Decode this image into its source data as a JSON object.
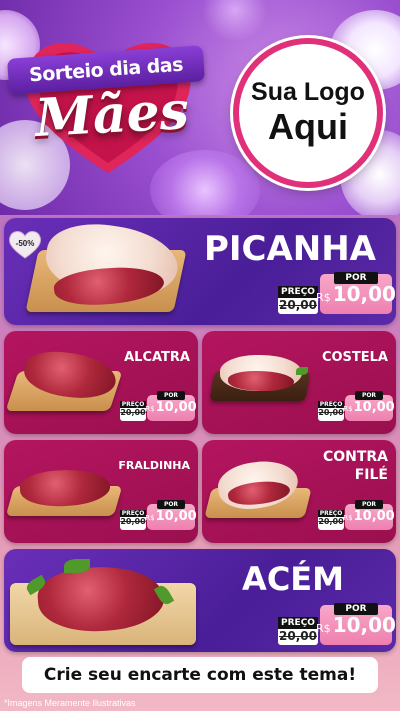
{
  "header": {
    "ribbon_text": "Sorteio dia das",
    "title": "Mães",
    "logo_line1": "Sua Logo",
    "logo_line2": "Aqui"
  },
  "badge": "-50%",
  "products": [
    {
      "name": "PICANHA",
      "price_label": "PREÇO",
      "old_price": "20,00",
      "por_label": "POR",
      "currency": "R$",
      "new_price": "10,00"
    },
    {
      "name": "ALCATRA",
      "price_label": "PREÇO",
      "old_price": "20,00",
      "por_label": "POR",
      "currency": "R$",
      "new_price": "10,00"
    },
    {
      "name": "COSTELA",
      "price_label": "PREÇO",
      "old_price": "20,00",
      "por_label": "POR",
      "currency": "R$",
      "new_price": "10,00"
    },
    {
      "name": "FRALDINHA",
      "price_label": "PREÇO",
      "old_price": "20,00",
      "por_label": "POR",
      "currency": "R$",
      "new_price": "10,00"
    },
    {
      "name_line1": "CONTRA",
      "name_line2": "FILÉ",
      "price_label": "PREÇO",
      "old_price": "20,00",
      "por_label": "POR",
      "currency": "R$",
      "new_price": "10,00"
    },
    {
      "name": "ACÉM",
      "price_label": "PREÇO",
      "old_price": "20,00",
      "por_label": "POR",
      "currency": "R$",
      "new_price": "10,00"
    }
  ],
  "cta": "Crie seu encarte com este tema!",
  "disclaimer": "*Imagens Meramente Ilustrativas",
  "colors": {
    "purple_panel": "#4a1e98",
    "magenta_panel": "#9a0f4f",
    "price_pink": "#ee7fb0",
    "logo_ring": "#e0307a"
  }
}
